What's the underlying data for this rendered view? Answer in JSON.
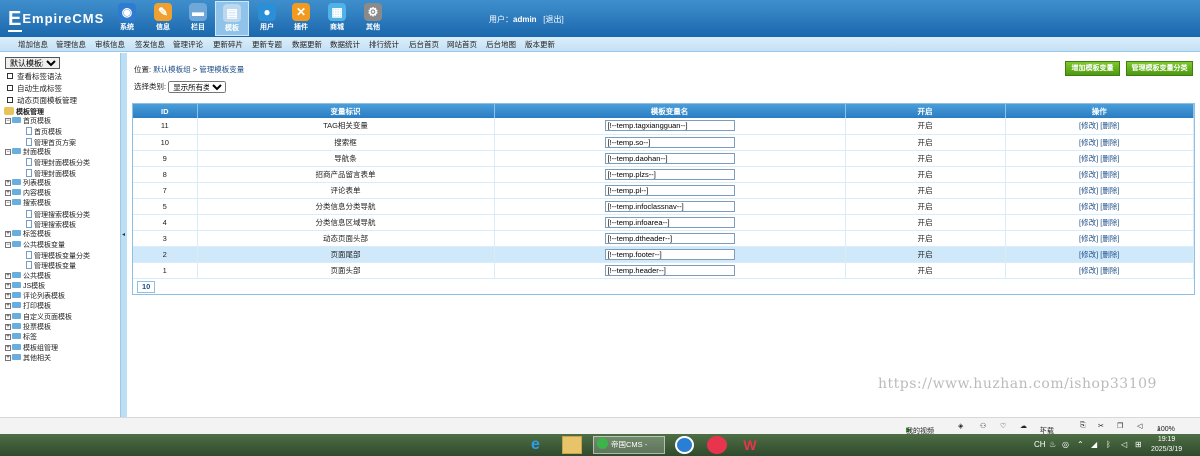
{
  "header": {
    "logo": "EmpireCMS",
    "nav": [
      {
        "label": "系统",
        "icon": "globe-icon"
      },
      {
        "label": "信息",
        "icon": "pencil-icon"
      },
      {
        "label": "栏目",
        "icon": "folder-icon"
      },
      {
        "label": "模板",
        "icon": "template-icon"
      },
      {
        "label": "用户",
        "icon": "user-icon"
      },
      {
        "label": "插件",
        "icon": "plugin-icon"
      },
      {
        "label": "商城",
        "icon": "shop-icon"
      },
      {
        "label": "其他",
        "icon": "gear-icon"
      }
    ],
    "user_prefix": "用户：",
    "username": "admin",
    "logout": "[退出]"
  },
  "subnav": [
    "增加信息",
    "管理信息",
    "审核信息",
    "签发信息",
    "管理评论",
    "更新碎片",
    "更新专题",
    "数据更新",
    "数据统计",
    "排行统计",
    "后台首页",
    "网站首页",
    "后台地图",
    "版本更新"
  ],
  "sidebar": {
    "group_select": "默认模板组",
    "links": [
      "查看标签语法",
      "自动生成标签",
      "动态页面模板管理"
    ],
    "tree_title": "模板管理",
    "tree": [
      {
        "label": "首页模板",
        "type": "open"
      },
      {
        "label": "首页模板",
        "type": "leaf"
      },
      {
        "label": "管理首页方案",
        "type": "leaf"
      },
      {
        "label": "封面模板",
        "type": "open"
      },
      {
        "label": "管理封面模板分类",
        "type": "leaf"
      },
      {
        "label": "管理封面模板",
        "type": "leaf"
      },
      {
        "label": "列表模板",
        "type": "closed"
      },
      {
        "label": "内容模板",
        "type": "closed"
      },
      {
        "label": "搜索模板",
        "type": "open"
      },
      {
        "label": "管理搜索模板分类",
        "type": "leaf"
      },
      {
        "label": "管理搜索模板",
        "type": "leaf"
      },
      {
        "label": "标签模板",
        "type": "closed"
      },
      {
        "label": "公共模板变量",
        "type": "open"
      },
      {
        "label": "管理模板变量分类",
        "type": "leaf"
      },
      {
        "label": "管理模板变量",
        "type": "leaf"
      },
      {
        "label": "公共模板",
        "type": "closed"
      },
      {
        "label": "JS模板",
        "type": "closed"
      },
      {
        "label": "评论列表模板",
        "type": "closed"
      },
      {
        "label": "打印模板",
        "type": "closed"
      },
      {
        "label": "自定义页面模板",
        "type": "closed"
      },
      {
        "label": "投票模板",
        "type": "closed"
      },
      {
        "label": "标签",
        "type": "closed"
      },
      {
        "label": "模板组管理",
        "type": "closed"
      },
      {
        "label": "其他相关",
        "type": "closed"
      }
    ],
    "collapse_glyph": "◂"
  },
  "main": {
    "breadcrumb_prefix": "位置:",
    "breadcrumb_group": "默认模板组",
    "breadcrumb_sep": ">",
    "breadcrumb_page": "管理模板变量",
    "filter_label": "选择类别:",
    "filter_value": "显示所有类别",
    "btn_add": "增加模板变量",
    "btn_manage": "管理模板变量分类",
    "columns": [
      "ID",
      "变量标识",
      "模板变量名",
      "开启",
      "操作"
    ],
    "rows": [
      {
        "id": "11",
        "name": "TAG相关变量",
        "var": "[!--temp.tagxiangguan--]",
        "on": "开启"
      },
      {
        "id": "10",
        "name": "搜索框",
        "var": "[!--temp.so--]",
        "on": "开启"
      },
      {
        "id": "9",
        "name": "导航条",
        "var": "[!--temp.daohan--]",
        "on": "开启"
      },
      {
        "id": "8",
        "name": "招商产品留言表单",
        "var": "[!--temp.plzs--]",
        "on": "开启"
      },
      {
        "id": "7",
        "name": "评论表单",
        "var": "[!--temp.pl--]",
        "on": "开启"
      },
      {
        "id": "5",
        "name": "分类信息分类导航",
        "var": "[!--temp.infoclassnav--]",
        "on": "开启"
      },
      {
        "id": "4",
        "name": "分类信息区域导航",
        "var": "[!--temp.infoarea--]",
        "on": "开启"
      },
      {
        "id": "3",
        "name": "动态页面头部",
        "var": "[!--temp.dtheader--]",
        "on": "开启"
      },
      {
        "id": "2",
        "name": "页面尾部",
        "var": "[!--temp.footer--]",
        "on": "开启"
      },
      {
        "id": "1",
        "name": "页面头部",
        "var": "[!--temp.header--]",
        "on": "开启"
      }
    ],
    "edit_label": "[修改]",
    "delete_label": "[删除]",
    "pager_total": "10"
  },
  "watermark": "https://www.huzhan.com/ishop33109",
  "statusbar": {
    "video": "我的视频",
    "download": "下载",
    "zoom": "100%"
  },
  "taskbar": {
    "window_title": "帝国CMS -",
    "ime": "CH",
    "time": "19:19",
    "date": "2025/3/19"
  },
  "colors": {
    "header": "#1b68ad",
    "accent_green": "#5aa818",
    "table_head": "#2a7dc2",
    "row_highlight": "#cfe8fa"
  }
}
